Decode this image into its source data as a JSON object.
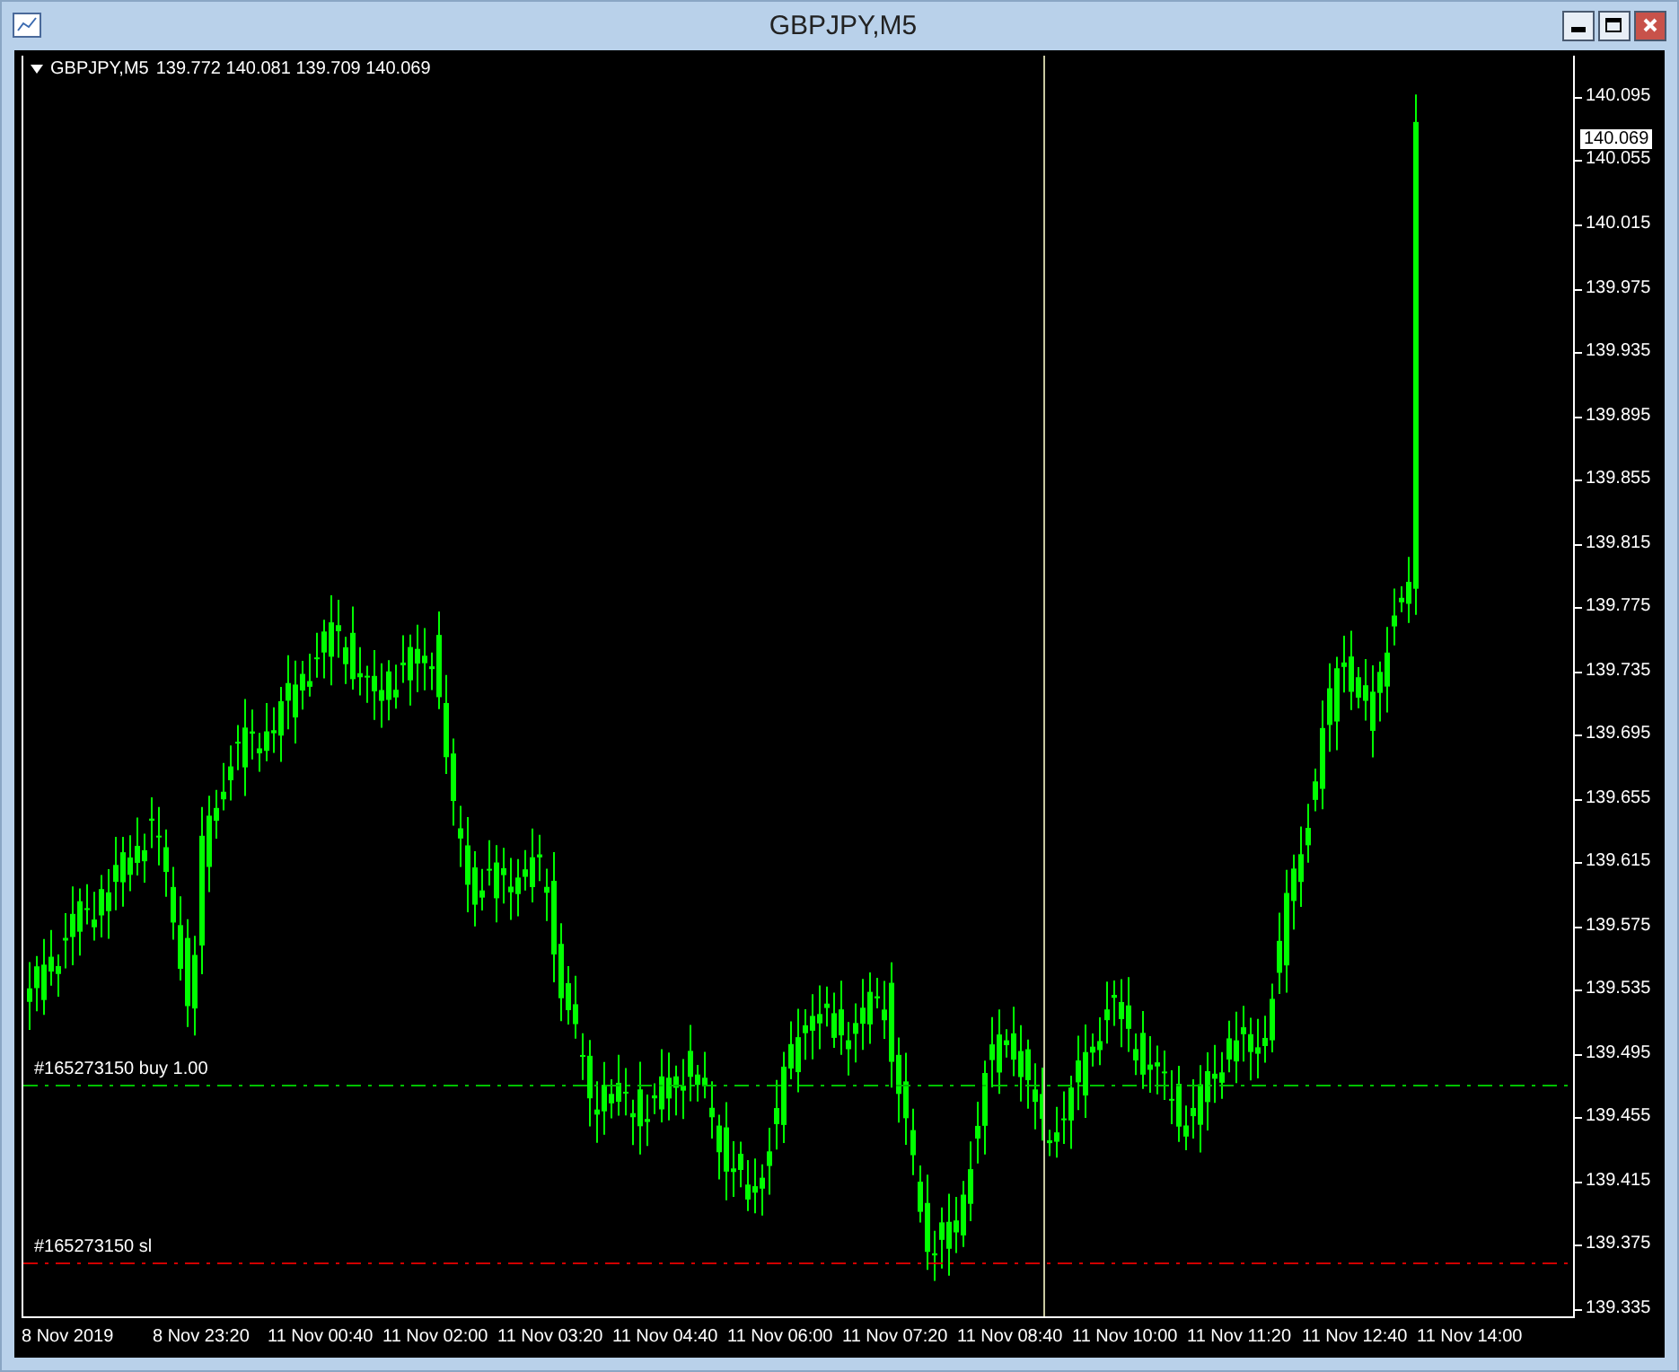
{
  "window": {
    "title": "GBPJPY,M5"
  },
  "header": {
    "symbol": "GBPJPY,M5",
    "prices": "139.772 140.081 139.709 140.069"
  },
  "price_axis": {
    "labels": [
      "140.095",
      "140.055",
      "140.015",
      "139.975",
      "139.935",
      "139.895",
      "139.855",
      "139.815",
      "139.775",
      "139.735",
      "139.695",
      "139.655",
      "139.615",
      "139.575",
      "139.535",
      "139.495",
      "139.455",
      "139.415",
      "139.375",
      "139.335"
    ],
    "current_price": "140.069"
  },
  "time_axis": {
    "labels": [
      "8 Nov 2019",
      "8 Nov 23:20",
      "11 Nov 00:40",
      "11 Nov 02:00",
      "11 Nov 03:20",
      "11 Nov 04:40",
      "11 Nov 06:00",
      "11 Nov 07:20",
      "11 Nov 08:40",
      "11 Nov 10:00",
      "11 Nov 11:20",
      "11 Nov 12:40",
      "11 Nov 14:00"
    ]
  },
  "order_lines": [
    {
      "label": "#165273150 buy 1.00",
      "color": "#00c000"
    },
    {
      "label": "#165273150 sl",
      "color": "#d00000"
    }
  ]
}
